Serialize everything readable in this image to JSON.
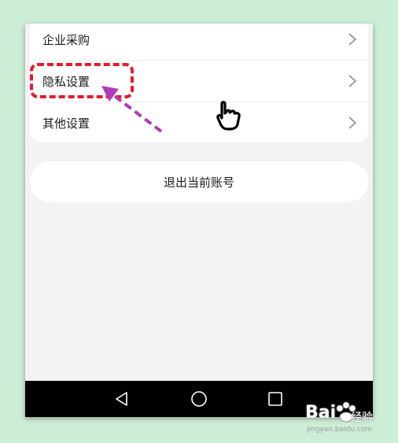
{
  "settings": {
    "items": [
      {
        "label": "企业采购"
      },
      {
        "label": "隐私设置"
      },
      {
        "label": "其他设置"
      }
    ]
  },
  "logout": {
    "label": "退出当前账号"
  },
  "navbar": {
    "icons": [
      "back-triangle-icon",
      "home-circle-icon",
      "recents-square-icon"
    ]
  },
  "annotation": {
    "highlight_color": "#e8192c",
    "arrow_color": "#b03bb5"
  },
  "watermark": {
    "brand": "Bai",
    "brand_cn": "经验",
    "url": "jingyan.baidu.com"
  }
}
